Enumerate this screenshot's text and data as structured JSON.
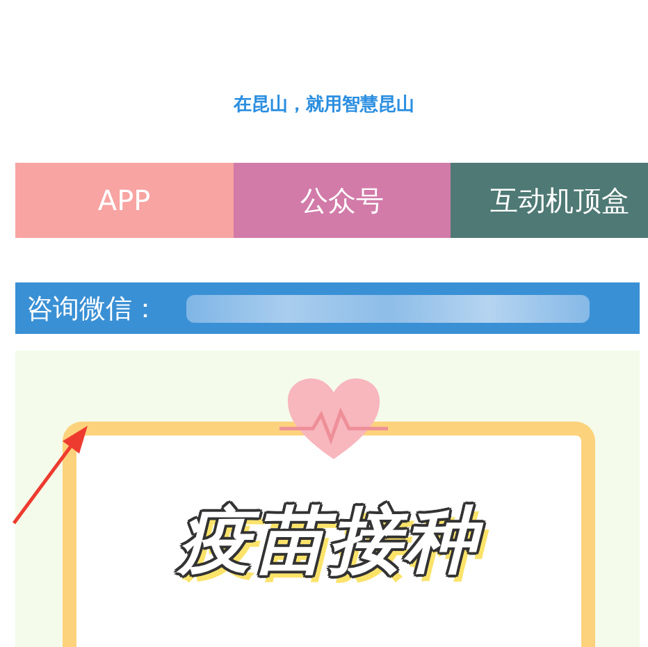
{
  "tagline": "在昆山，就用智慧昆山",
  "tabs": [
    {
      "label": "APP",
      "color": "#f7a4a2"
    },
    {
      "label": "公众号",
      "color": "#d27ba9"
    },
    {
      "label": "互动机顶盒",
      "color": "#4e7974"
    }
  ],
  "contact": {
    "label": "咨询微信："
  },
  "poster": {
    "title": "疫苗接种"
  }
}
